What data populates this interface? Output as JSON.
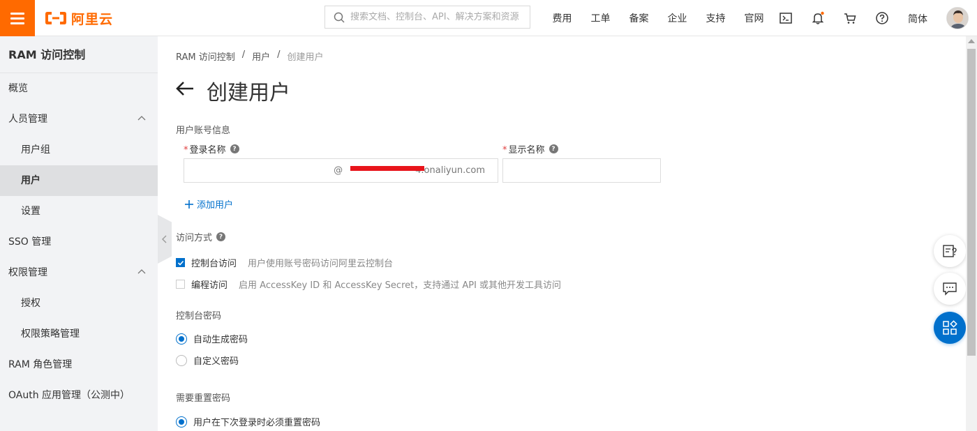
{
  "header": {
    "brand": "阿里云",
    "search_placeholder": "搜索文档、控制台、API、解决方案和资源",
    "nav": [
      "费用",
      "工单",
      "备案",
      "企业",
      "支持",
      "官网"
    ],
    "language": "简体",
    "accent_color": "#ff6a00"
  },
  "sidebar": {
    "title": "RAM 访问控制",
    "items": [
      {
        "label": "概览"
      },
      {
        "label": "人员管理"
      },
      {
        "label": "用户组"
      },
      {
        "label": "用户"
      },
      {
        "label": "设置"
      },
      {
        "label": "SSO 管理"
      },
      {
        "label": "权限管理"
      },
      {
        "label": "授权"
      },
      {
        "label": "权限策略管理"
      },
      {
        "label": "RAM 角色管理"
      },
      {
        "label": "OAuth 应用管理（公测中）"
      }
    ]
  },
  "main": {
    "breadcrumb": [
      "RAM 访问控制",
      "/",
      "用户",
      "/",
      "创建用户"
    ],
    "title": "创建用户",
    "account_section": "用户账号信息",
    "login_name_label": "登录名称",
    "login_name_suffix": "@",
    "login_name_domain": "4.onaliyun.com",
    "display_name_label": "显示名称",
    "add_user": "添加用户",
    "access_section": "访问方式",
    "console_access": {
      "label": "控制台访问",
      "desc": "用户使用账号密码访问阿里云控制台",
      "checked": true
    },
    "programmatic_access": {
      "label": "编程访问",
      "desc": "启用 AccessKey ID 和 AccessKey Secret，支持通过 API 或其他开发工具访问",
      "checked": false
    },
    "password_section": "控制台密码",
    "password_options": [
      {
        "label": "自动生成密码",
        "selected": true
      },
      {
        "label": "自定义密码",
        "selected": false
      }
    ],
    "reset_section": "需要重置密码",
    "reset_options": [
      {
        "label": "用户在下次登录时必须重置密码",
        "selected": true
      }
    ],
    "link_color": "#0070cc"
  }
}
